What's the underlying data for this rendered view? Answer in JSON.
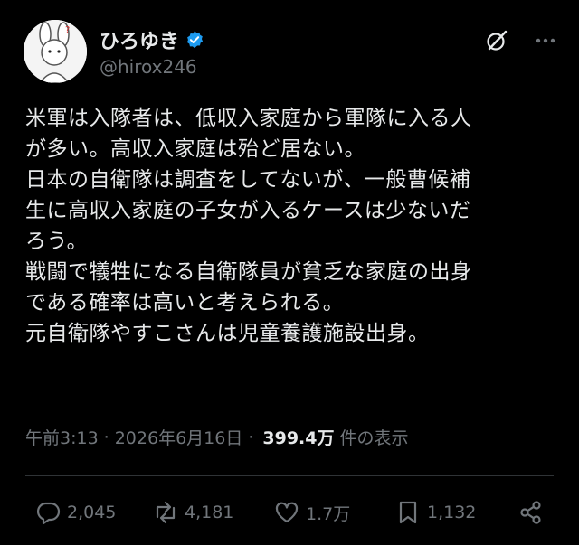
{
  "post": {
    "author": {
      "display_name": "ひろゆき",
      "handle": "@hirox246",
      "verified": true
    },
    "text": "米軍は入隊者は、低収入家庭から軍隊に入る人\nが多い。高収入家庭は殆ど居ない。\n日本の自衛隊は調査をしてないが、一般曹候補\n生に高収入家庭の子女が入るケースは少ないだ\nろう。\n戦闘で犠牲になる自衛隊員が貧乏な家庭の出身\nである確率は高いと考えられる。\n元自衛隊やすこさんは児童養護施設出身。",
    "time": "午前3:13",
    "date": "2026年6月16日",
    "separator": "·",
    "views": "399.4万",
    "views_label": "件の表示"
  },
  "actions": {
    "replies": "2,045",
    "reposts": "4,181",
    "likes": "1.7万",
    "bookmarks": "1,132"
  },
  "colors": {
    "background": "#000000",
    "text": "#e7e9ea",
    "secondary": "#71767b",
    "verified": "#1d9bf0",
    "divider": "#2f3336"
  },
  "icons": [
    "grok-icon",
    "more-icon",
    "reply-icon",
    "repost-icon",
    "like-icon",
    "bookmark-icon",
    "share-icon",
    "verified-badge-icon"
  ]
}
